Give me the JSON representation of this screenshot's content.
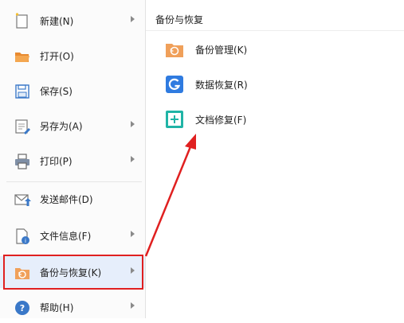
{
  "menu": {
    "items": [
      {
        "label": "新建(N)",
        "icon": "new-doc-icon",
        "has_submenu": true
      },
      {
        "label": "打开(O)",
        "icon": "folder-open-icon",
        "has_submenu": false
      },
      {
        "label": "保存(S)",
        "icon": "save-icon",
        "has_submenu": false
      },
      {
        "label": "另存为(A)",
        "icon": "save-as-icon",
        "has_submenu": true
      },
      {
        "label": "打印(P)",
        "icon": "printer-icon",
        "has_submenu": true
      },
      {
        "label": "发送邮件(D)",
        "icon": "mail-icon",
        "has_submenu": false
      },
      {
        "label": "文件信息(F)",
        "icon": "file-info-icon",
        "has_submenu": true
      },
      {
        "label": "备份与恢复(K)",
        "icon": "backup-restore-icon",
        "has_submenu": true,
        "active": true
      },
      {
        "label": "帮助(H)",
        "icon": "help-icon",
        "has_submenu": true
      }
    ]
  },
  "panel": {
    "title": "备份与恢复",
    "items": [
      {
        "label": "备份管理(K)",
        "icon": "backup-manage-icon"
      },
      {
        "label": "数据恢复(R)",
        "icon": "data-recovery-icon"
      },
      {
        "label": "文档修复(F)",
        "icon": "doc-repair-icon"
      }
    ]
  },
  "colors": {
    "accent_orange": "#f0a05a",
    "accent_blue": "#2f7be0",
    "accent_teal": "#20b4a6",
    "annotation_red": "#e02020",
    "active_bg": "#e6eefb"
  }
}
